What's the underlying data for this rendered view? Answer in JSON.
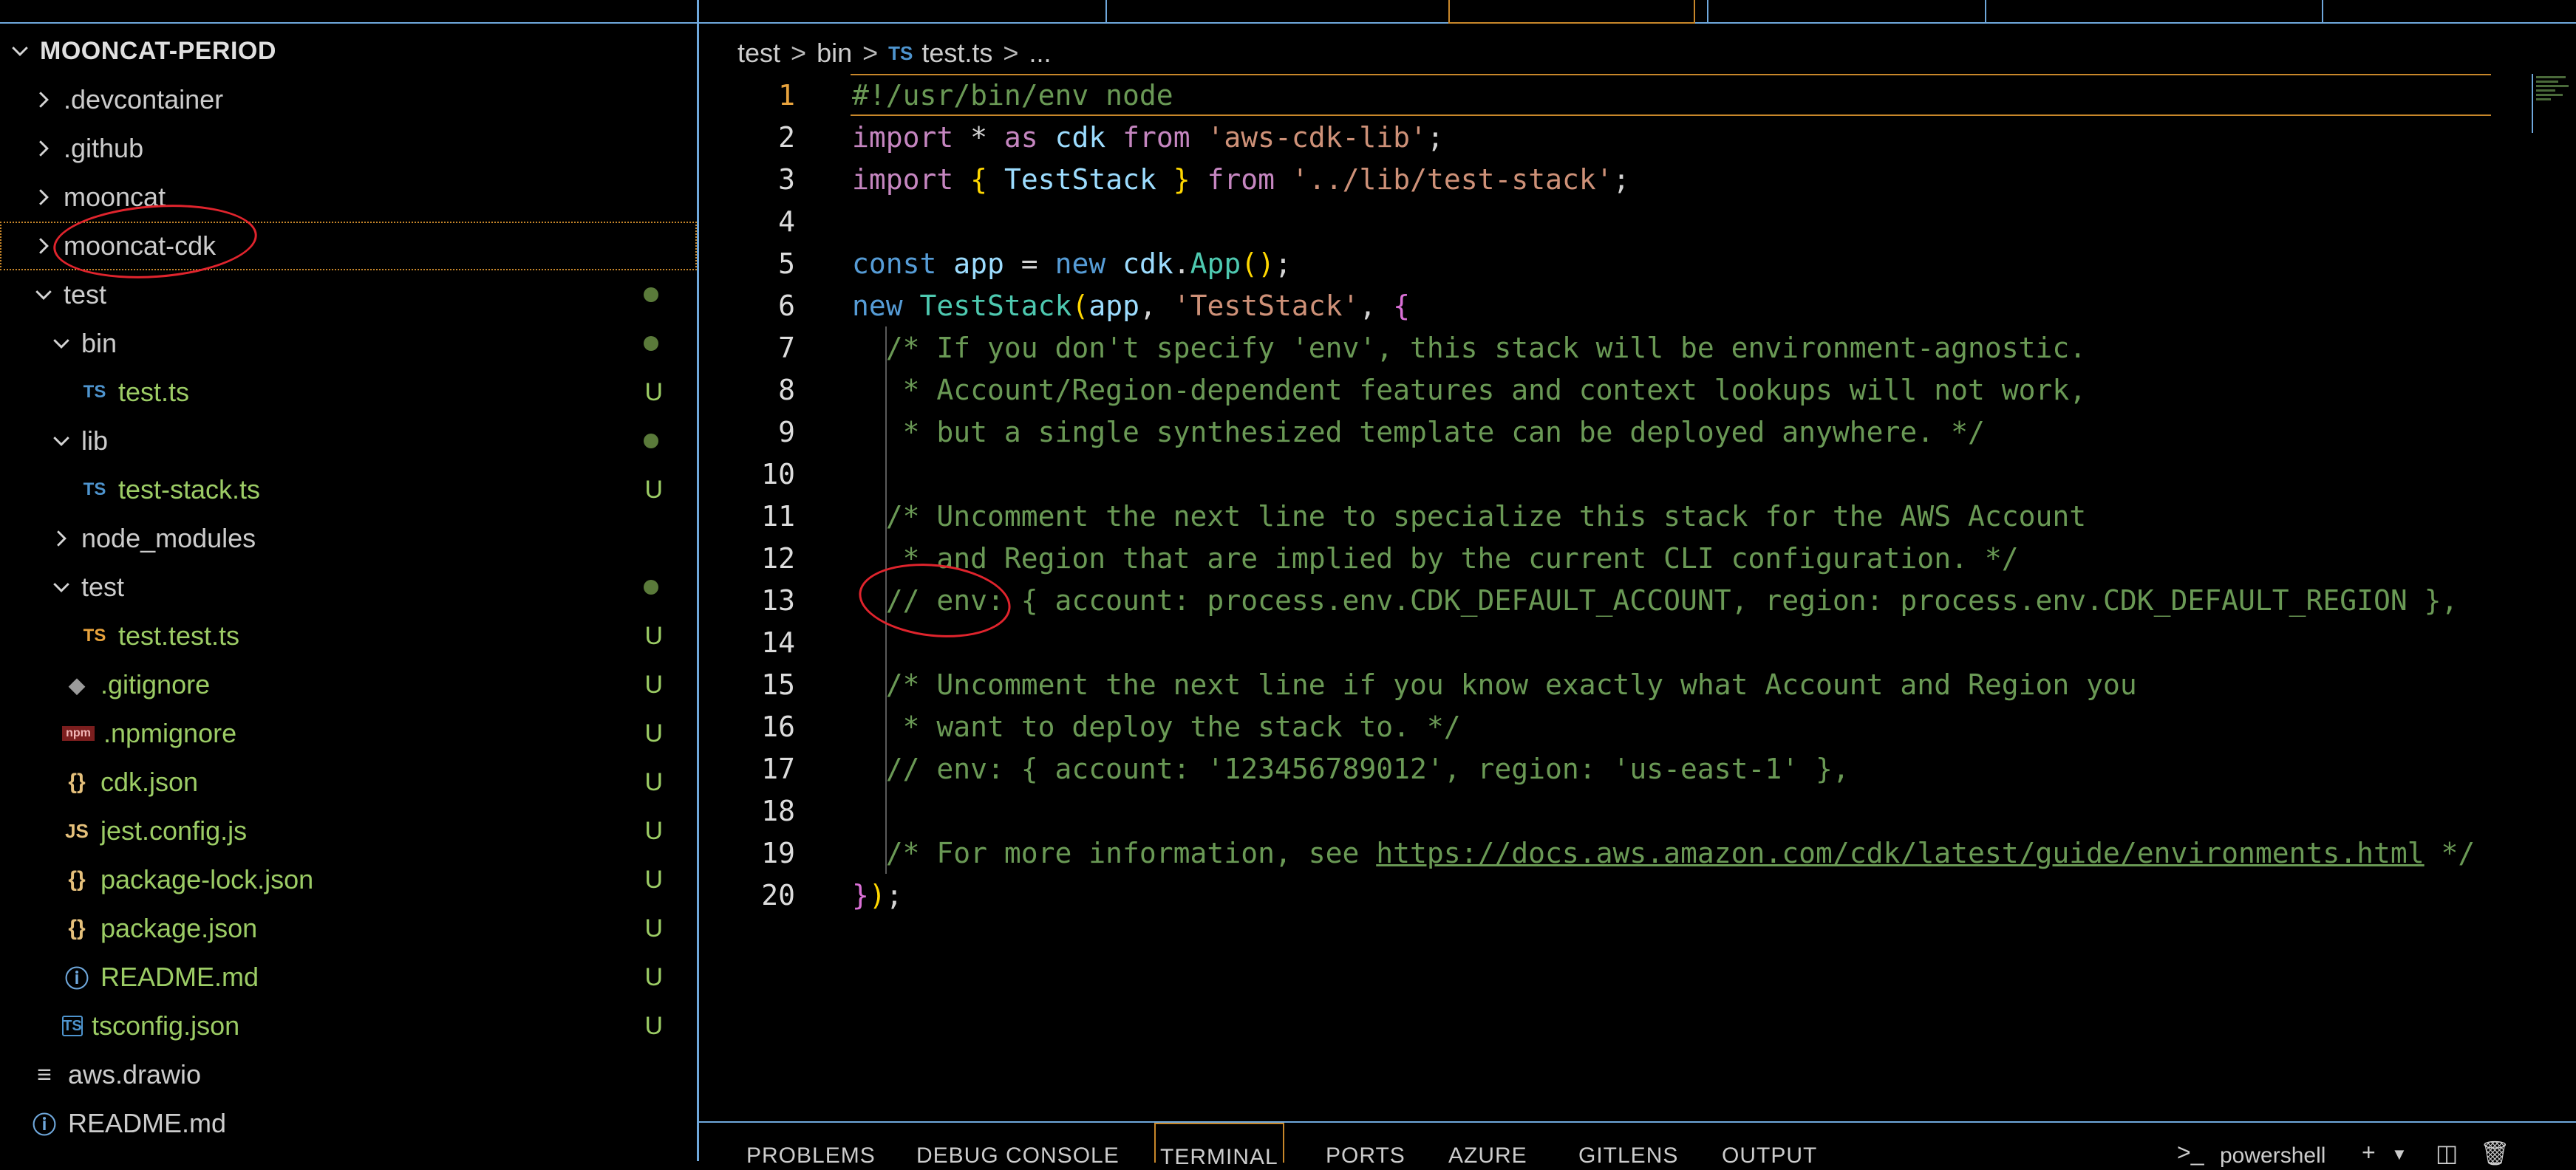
{
  "explorer": {
    "root": "MOONCAT-PERIOD",
    "items": [
      {
        "label": ".devcontainer",
        "type": "folder-collapsed",
        "status": ""
      },
      {
        "label": ".github",
        "type": "folder-collapsed",
        "status": ""
      },
      {
        "label": "mooncat",
        "type": "folder-collapsed",
        "status": ""
      },
      {
        "label": "mooncat-cdk",
        "type": "folder-collapsed",
        "status": ""
      },
      {
        "label": "test",
        "type": "folder-expanded",
        "status": "dot"
      },
      {
        "label": "bin",
        "type": "folder-expanded",
        "status": "dot"
      },
      {
        "label": "test.ts",
        "type": "file-ts",
        "status": "U"
      },
      {
        "label": "lib",
        "type": "folder-expanded",
        "status": "dot"
      },
      {
        "label": "test-stack.ts",
        "type": "file-ts",
        "status": "U"
      },
      {
        "label": "node_modules",
        "type": "folder-collapsed",
        "status": ""
      },
      {
        "label": "test",
        "type": "folder-expanded",
        "status": "dot"
      },
      {
        "label": "test.test.ts",
        "type": "file-ts-test",
        "status": "U"
      },
      {
        "label": ".gitignore",
        "type": "file-git",
        "status": "U"
      },
      {
        "label": ".npmignore",
        "type": "file-npm",
        "status": "U"
      },
      {
        "label": "cdk.json",
        "type": "file-json",
        "status": "U"
      },
      {
        "label": "jest.config.js",
        "type": "file-js",
        "status": "U"
      },
      {
        "label": "package-lock.json",
        "type": "file-json",
        "status": "U"
      },
      {
        "label": "package.json",
        "type": "file-json",
        "status": "U"
      },
      {
        "label": "README.md",
        "type": "file-info",
        "status": "U"
      },
      {
        "label": "tsconfig.json",
        "type": "file-tsconfig",
        "status": "U"
      },
      {
        "label": "aws.drawio",
        "type": "file-lines",
        "status": ""
      },
      {
        "label": "README.md",
        "type": "file-info",
        "status": ""
      }
    ]
  },
  "breadcrumb": {
    "parts": [
      "test",
      "bin",
      "test.ts",
      "..."
    ],
    "file_icon": "TS"
  },
  "editor": {
    "current_line": 1,
    "lines": [
      {
        "n": "1",
        "tokens": [
          [
            "#!/usr/bin/env node",
            "cm"
          ]
        ]
      },
      {
        "n": "2",
        "tokens": [
          [
            "import",
            "kw2"
          ],
          [
            " * ",
            "pl"
          ],
          [
            "as",
            "kw2"
          ],
          [
            " ",
            "pl"
          ],
          [
            "cdk",
            "var"
          ],
          [
            " ",
            "pl"
          ],
          [
            "from",
            "kw2"
          ],
          [
            " ",
            "pl"
          ],
          [
            "'aws-cdk-lib'",
            "str"
          ],
          [
            ";",
            "pl"
          ]
        ]
      },
      {
        "n": "3",
        "tokens": [
          [
            "import",
            "kw2"
          ],
          [
            " ",
            "pl"
          ],
          [
            "{",
            "br"
          ],
          [
            " ",
            "pl"
          ],
          [
            "TestStack",
            "var"
          ],
          [
            " ",
            "pl"
          ],
          [
            "}",
            "br"
          ],
          [
            " ",
            "pl"
          ],
          [
            "from",
            "kw2"
          ],
          [
            " ",
            "pl"
          ],
          [
            "'../lib/test-stack'",
            "str"
          ],
          [
            ";",
            "pl"
          ]
        ]
      },
      {
        "n": "4",
        "tokens": []
      },
      {
        "n": "5",
        "tokens": [
          [
            "const",
            "kw"
          ],
          [
            " ",
            "pl"
          ],
          [
            "app",
            "var"
          ],
          [
            " = ",
            "pl"
          ],
          [
            "new",
            "kw"
          ],
          [
            " ",
            "pl"
          ],
          [
            "cdk",
            "var"
          ],
          [
            ".",
            "pl"
          ],
          [
            "App",
            "cls"
          ],
          [
            "()",
            "br"
          ],
          [
            ";",
            "pl"
          ]
        ]
      },
      {
        "n": "6",
        "tokens": [
          [
            "new",
            "kw"
          ],
          [
            " ",
            "pl"
          ],
          [
            "TestStack",
            "cls"
          ],
          [
            "(",
            "br"
          ],
          [
            "app",
            "var"
          ],
          [
            ", ",
            "pl"
          ],
          [
            "'TestStack'",
            "str"
          ],
          [
            ", ",
            "pl"
          ],
          [
            "{",
            "br2"
          ]
        ]
      },
      {
        "n": "7",
        "tokens": [
          [
            "  /* If you don't specify 'env', this stack will be environment-agnostic.",
            "cm"
          ]
        ]
      },
      {
        "n": "8",
        "tokens": [
          [
            "   * Account/Region-dependent features and context lookups will not work,",
            "cm"
          ]
        ]
      },
      {
        "n": "9",
        "tokens": [
          [
            "   * but a single synthesized template can be deployed anywhere. */",
            "cm"
          ]
        ]
      },
      {
        "n": "10",
        "tokens": []
      },
      {
        "n": "11",
        "tokens": [
          [
            "  /* Uncomment the next line to specialize this stack for the AWS Account",
            "cm"
          ]
        ]
      },
      {
        "n": "12",
        "tokens": [
          [
            "   * and Region that are implied by the current CLI configuration. */",
            "cm"
          ]
        ]
      },
      {
        "n": "13",
        "tokens": [
          [
            "  // env: { account: process.env.CDK_DEFAULT_ACCOUNT, region: process.env.CDK_DEFAULT_REGION },",
            "cm"
          ]
        ]
      },
      {
        "n": "14",
        "tokens": []
      },
      {
        "n": "15",
        "tokens": [
          [
            "  /* Uncomment the next line if you know exactly what Account and Region you",
            "cm"
          ]
        ]
      },
      {
        "n": "16",
        "tokens": [
          [
            "   * want to deploy the stack to. */",
            "cm"
          ]
        ]
      },
      {
        "n": "17",
        "tokens": [
          [
            "  // env: { account: '123456789012', region: 'us-east-1' },",
            "cm"
          ]
        ]
      },
      {
        "n": "18",
        "tokens": []
      },
      {
        "n": "19",
        "tokens": [
          [
            "  /* For more information, see ",
            "cm"
          ],
          [
            "https://docs.aws.amazon.com/cdk/latest/guide/environments.html",
            "link"
          ],
          [
            " */",
            "cm"
          ]
        ]
      },
      {
        "n": "20",
        "tokens": [
          [
            "}",
            "br2"
          ],
          [
            ")",
            "br"
          ],
          [
            ";",
            "pl"
          ]
        ]
      }
    ]
  },
  "panel": {
    "tabs": [
      "PROBLEMS",
      "DEBUG CONSOLE",
      "TERMINAL",
      "PORTS",
      "AZURE",
      "GITLENS",
      "OUTPUT"
    ],
    "active_tab": "TERMINAL",
    "terminal_name": "powershell"
  },
  "colors": {
    "accent_border": "#6fa8dc",
    "focus_border": "#c8872a",
    "annotation": "#e0242d",
    "untracked": "#9ccc65"
  }
}
